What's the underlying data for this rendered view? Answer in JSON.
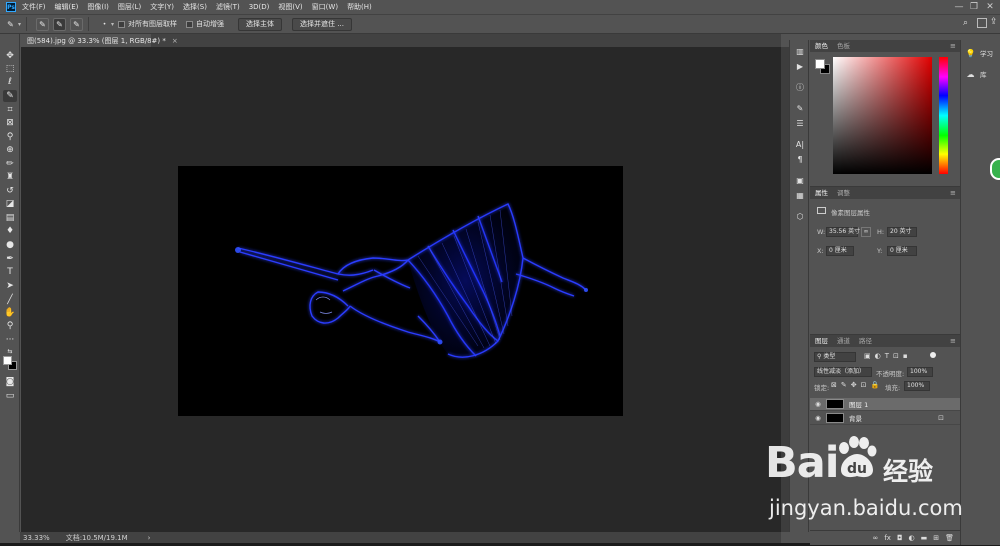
{
  "menubar": {
    "logo": "Ps",
    "items": [
      "文件(F)",
      "编辑(E)",
      "图像(I)",
      "图层(L)",
      "文字(Y)",
      "选择(S)",
      "滤镜(T)",
      "3D(D)",
      "视图(V)",
      "窗口(W)",
      "帮助(H)"
    ],
    "window_controls": [
      "—",
      "❐",
      "✕"
    ]
  },
  "options": {
    "sample_all_layers": "对所有图层取样",
    "auto_enhance": "自动增强",
    "select_subject": "选择主体",
    "select_and_mask": "选择并遮住 ..."
  },
  "document": {
    "tab_title": "图(584).jpg @ 33.3% (图层 1, RGB/8#) *",
    "close": "×"
  },
  "status": {
    "zoom": "33.33%",
    "doc_size": "文档:10.5M/19.1M",
    "arrow": "›"
  },
  "color_panel": {
    "tabs": [
      "颜色",
      "色板"
    ],
    "menu": "≡",
    "fg_color": "#ffffff",
    "bg_color": "#000000"
  },
  "properties_panel": {
    "tabs": [
      "属性",
      "调整"
    ],
    "title": "像素图层属性",
    "w_label": "W:",
    "w_value": "35.56 英寸",
    "h_label": "H:",
    "h_value": "20 英寸",
    "x_label": "X:",
    "x_value": "0 厘米",
    "y_label": "Y:",
    "y_value": "0 厘米"
  },
  "layers_panel": {
    "tabs": [
      "图层",
      "通道",
      "路径"
    ],
    "filter_kind": "类型",
    "blend_mode": "线性减淡（添加）",
    "opacity_label": "不透明度:",
    "opacity_value": "100%",
    "lock_label": "锁定:",
    "fill_label": "填充:",
    "fill_value": "100%",
    "layers": [
      {
        "name": "图层 1",
        "selected": true
      },
      {
        "name": "背景",
        "selected": false
      }
    ]
  },
  "right_strip": {
    "learn": "学习",
    "library": "库"
  },
  "watermark": {
    "brand": "Bai",
    "brand_suffix": "du",
    "product": "经验",
    "url": "jingyan.baidu.com"
  }
}
